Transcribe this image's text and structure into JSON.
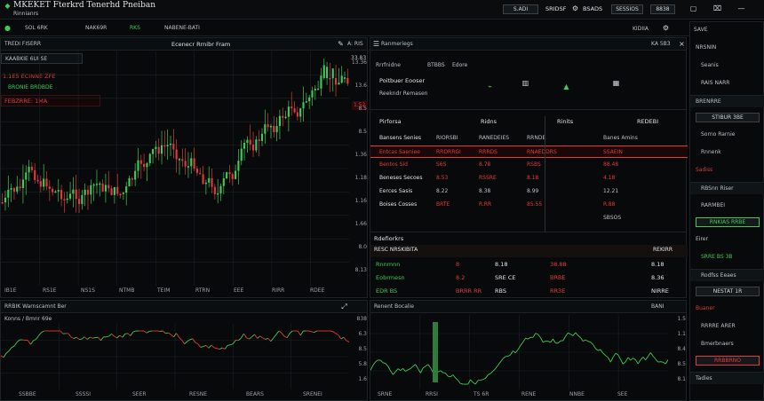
{
  "colors": {
    "up": "#3ecb57",
    "down": "#e23a3a",
    "bg": "#050607",
    "panel": "#07090a",
    "grid": "#1c2226"
  },
  "window": {
    "title": "MKEKET Fterkrd Tenerhd Pneiban",
    "subtitle": "Rinnianrs"
  },
  "topbar": {
    "btn1": "S.ADI",
    "btn2": "SRIDSF",
    "btn3": "BSADS",
    "btn4": "SESSIOS",
    "btn5": "8838"
  },
  "tabs": [
    "SOL 6RK",
    "NAK69R",
    "RKS",
    "NABENE-BATI"
  ],
  "right_header": {
    "left": "KIDIIA",
    "right": "SAVE"
  },
  "main_chart": {
    "tab": "TREDI FISERR",
    "title": "Ecenecr Rrnibr Fram",
    "toolbar": "KAABKIE 6UI SE",
    "line1": "1.1E5 ECINNE ZFE",
    "badge": "FEBZRRE: 1MA",
    "line2": "BRONIE BRDBDE",
    "top_right": "A: RIS",
    "top_right2": "33.83",
    "price_tag": "1.52",
    "y_ticks": [
      "13.36",
      "13.6",
      "8.5",
      "8.5",
      "1.36",
      "1.18",
      "1.16",
      "1.66",
      "8.0",
      "8.13"
    ],
    "x_ticks": [
      "IB1E",
      "RS1E",
      "NS1S",
      "NTMB",
      "TEIM",
      "RTRN",
      "EEE",
      "RIRR",
      "RDEE"
    ]
  },
  "mid_panel": {
    "tab": "Ranmeriegs",
    "tab_right": "KA 5B3",
    "sub_tabs": [
      "Rrrfnidne",
      "BTBBS",
      "Edore"
    ],
    "section1": "Poitbuer Eooser",
    "section2": "Reekndr Remasen",
    "table1": {
      "headers": [
        "Pirforsa",
        "Ridns",
        "Rinits",
        "REDEBI"
      ],
      "rows": [
        [
          "Bansens Senies",
          "RIORSBI",
          "RANEDEIES",
          "RRNDE",
          "Banes Amins"
        ],
        [
          "Entcas Saeniee",
          "RRORRGI",
          "RRRDS",
          "RNAEDDRS",
          "SSAEIN"
        ],
        [
          "Bentos Sid",
          "S6S",
          "8.78",
          "RSBS",
          "88.48"
        ],
        [
          "Beneses Secoes",
          "8.53",
          "RSSRE",
          "8.18",
          "4.18"
        ],
        [
          "Eerces Sasis",
          "8.22",
          "8.38",
          "8.99",
          "12.21"
        ],
        [
          "Boises Cosses",
          "BRTE",
          "R.RR",
          "85.55",
          "R.88"
        ],
        [
          "",
          "",
          "",
          "",
          "SBSOS"
        ]
      ]
    },
    "table2": {
      "title": "Rdefiorkrs",
      "headers": [
        "RESC NRSKIBITA",
        "",
        "",
        "",
        "REKIRR"
      ],
      "rows": [
        [
          "Rnnmnn",
          "8",
          "8.18",
          "38.88",
          "8.18"
        ],
        [
          "Eobrmesn",
          "8.2",
          "SRE CE",
          "BRBE",
          "8.36"
        ],
        [
          "EDR BS",
          "BRRR RR",
          "RBS",
          "RR3E",
          "NIRRE"
        ]
      ]
    }
  },
  "right_sidebar": {
    "items": [
      "NRSNIN",
      "Seanis",
      "RAIS NARR",
      "BRENRRE",
      "Sorno Rarnie",
      "Rnnenk",
      "Sadiss",
      "RBSnn Riser",
      "RARMBEI",
      "Eirer",
      "SRRE BS 3B",
      "Rodfss Eeaes",
      "Buaner",
      "RRRRE ARER",
      "Bmerbnaers",
      "Tadies"
    ],
    "buttons": [
      "STIBUR 3BE",
      "RNKIAS RRBE",
      "NESTAT 1R",
      "RRBBRNO"
    ]
  },
  "bottom_left": {
    "tab": "RRBIK Warnscamnt Ber",
    "sub": "Konns / Bmnr 69e",
    "x_ticks": [
      "SSBBE",
      "SSSSI",
      "SEER",
      "RESNE",
      "BEARS",
      "SRENEI"
    ],
    "y_ticks": [
      "838",
      "6.3",
      "8.5",
      "5.8",
      "1.6"
    ]
  },
  "bottom_mid": {
    "tab": "Renent Bocalie",
    "tab_right": "BANI",
    "x_ticks": [
      "SRNE",
      "RRSI",
      "TS 6R",
      "RENE",
      "NNBE",
      "SEE"
    ],
    "y_ticks": [
      "1.5",
      "1.1",
      "8.4",
      "8.5",
      "8.1"
    ]
  }
}
